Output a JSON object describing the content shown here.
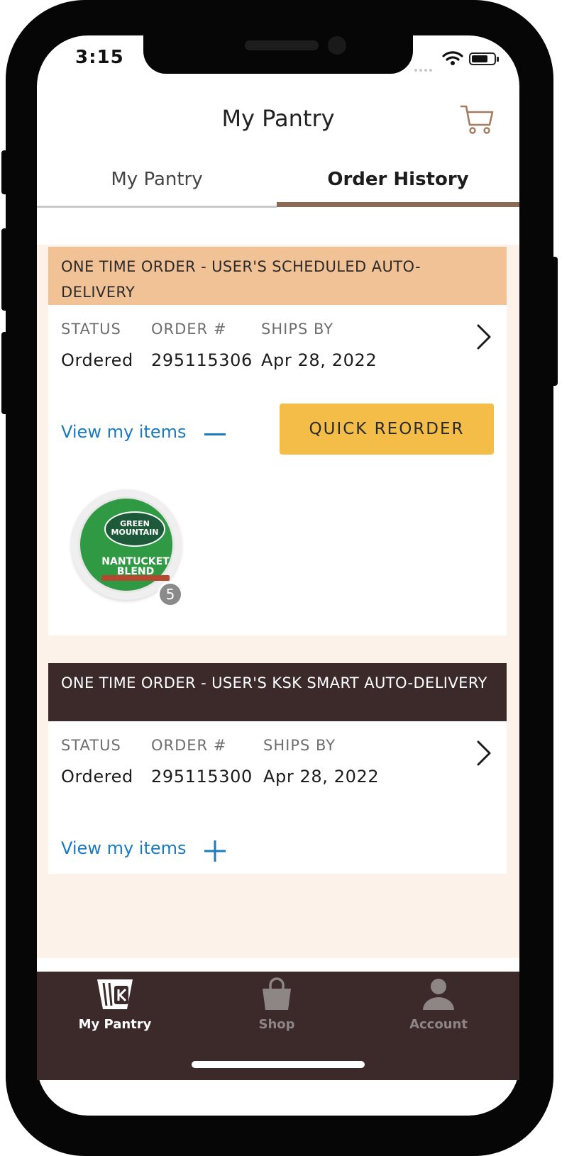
{
  "status_bar": {
    "time": "3:15"
  },
  "header": {
    "title": "My Pantry",
    "cart_icon": "shopping-cart-icon"
  },
  "tabs": [
    {
      "label": "My Pantry",
      "active": false
    },
    {
      "label": "Order History",
      "active": true
    }
  ],
  "orders": [
    {
      "header": "ONE TIME ORDER - USER'S SCHEDULED AUTO-DELIVERY",
      "header_color": "#f2c297",
      "status_label": "STATUS",
      "status": "Ordered",
      "order_label": "ORDER #",
      "order_number": "295115306",
      "ships_label": "SHIPS BY",
      "ships_by": "Apr 28, 2022",
      "view_items_label": "View my items",
      "expanded": true,
      "quick_reorder_label": "QUICK REORDER",
      "items": [
        {
          "brand": "GREEN MOUNTAIN",
          "name": "NANTUCKET BLEND",
          "quantity": "5"
        }
      ]
    },
    {
      "header": "ONE TIME ORDER - USER'S KSK SMART AUTO-DELIVERY",
      "header_color": "#3c2a2b",
      "status_label": "STATUS",
      "status": "Ordered",
      "order_label": "ORDER #",
      "order_number": "295115300",
      "ships_label": "SHIPS BY",
      "ships_by": "Apr 28, 2022",
      "view_items_label": "View my items",
      "expanded": false
    }
  ],
  "bottom_nav": [
    {
      "label": "My Pantry",
      "icon": "pantry-cup-icon",
      "active": true
    },
    {
      "label": "Shop",
      "icon": "shopping-bag-icon",
      "active": false
    },
    {
      "label": "Account",
      "icon": "person-icon",
      "active": false
    }
  ],
  "colors": {
    "accent_gold": "#f4bd48",
    "link_blue": "#1a7bbf",
    "dark_brown": "#3c2a2b",
    "tab_underline": "#8a6a55",
    "content_bg": "#fcf2ea"
  }
}
